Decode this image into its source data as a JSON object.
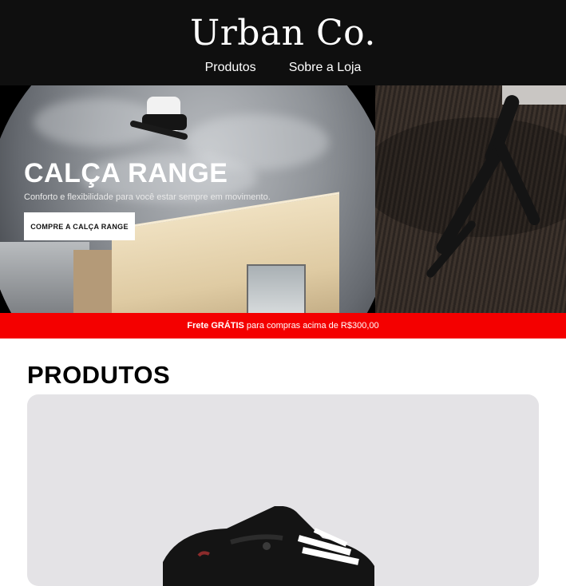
{
  "header": {
    "brand": "Urban Co.",
    "nav": [
      "Produtos",
      "Sobre a Loja"
    ]
  },
  "hero": {
    "title": "CALÇA RANGE",
    "subtitle": "Conforto e flexibilidade para você estar sempre em movimento.",
    "cta": "COMPRE A CALÇA RANGE"
  },
  "promo": {
    "bold": "Frete GRÁTIS",
    "text": " para compras acima de R$300,00"
  },
  "products": {
    "title": "PRODUTOS"
  },
  "colors": {
    "header_bg": "#0f0f0f",
    "promo_bg": "#f40000",
    "card_bg": "#e4e3e6"
  }
}
